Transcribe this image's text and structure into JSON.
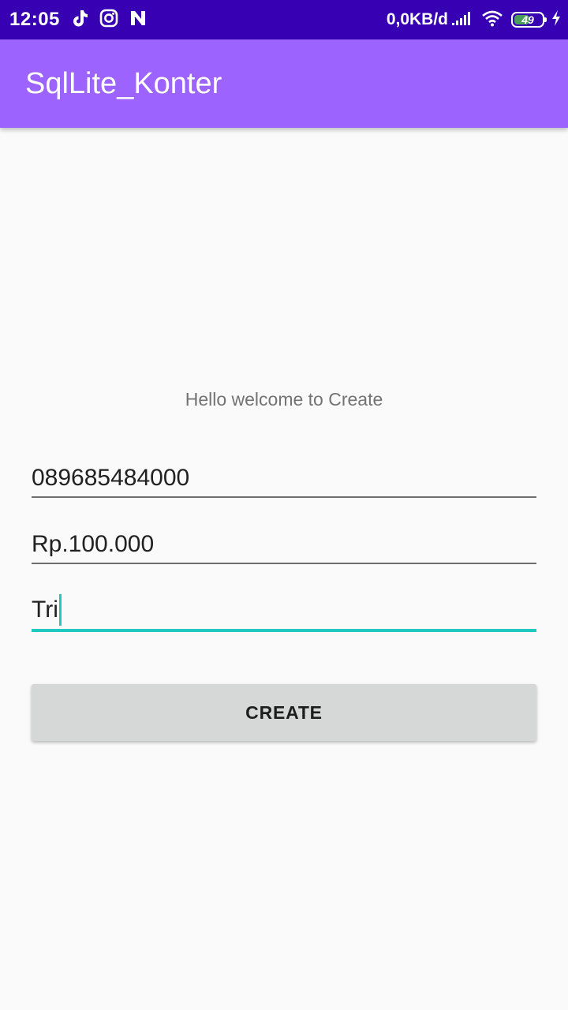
{
  "status_bar": {
    "time": "12:05",
    "network_speed": "0,0KB/d",
    "battery_level": "49",
    "icons": [
      "tiktok-icon",
      "instagram-icon",
      "n-app-icon",
      "signal-icon",
      "wifi-icon",
      "battery-icon",
      "charging-icon"
    ],
    "color": "#3700b3"
  },
  "app_bar": {
    "title": "SqlLite_Konter",
    "color": "#9d63ff"
  },
  "main": {
    "welcome_text": "Hello welcome to Create",
    "fields": [
      {
        "value": "089685484000",
        "focused": false
      },
      {
        "value": "Rp.100.000",
        "focused": false
      },
      {
        "value": "Tri",
        "focused": true
      }
    ],
    "create_button_label": "CREATE",
    "accent_color": "#1fc9c0"
  }
}
